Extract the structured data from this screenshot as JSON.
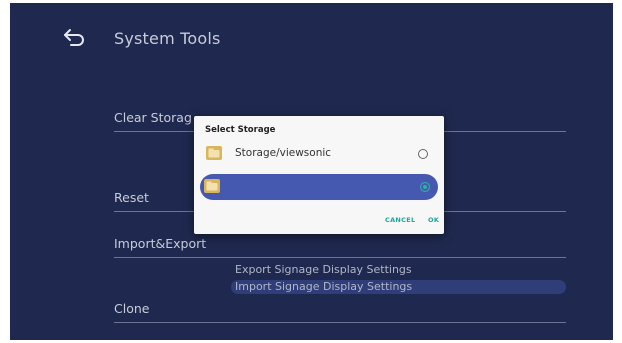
{
  "header": {
    "title": "System Tools"
  },
  "settings": {
    "clear_storage": "Clear Storag",
    "reset": "Reset",
    "import_export": "Import&Export",
    "import_export_options": [
      "Export Signage Display Settings",
      "Import Signage Display Settings"
    ],
    "clone": "Clone"
  },
  "dialog": {
    "title": "Select Storage",
    "options": [
      {
        "label": "Storage/viewsonic",
        "selected": false
      },
      {
        "label": "",
        "selected": true
      }
    ],
    "cancel_label": "CANCEL",
    "ok_label": "OK"
  },
  "colors": {
    "background": "#1f294f",
    "accent": "#1ba79a",
    "highlight": "#4659b0"
  },
  "icons": {
    "back": "back-arrow-icon",
    "folder": "folder-icon",
    "radio": "radio-icon"
  }
}
